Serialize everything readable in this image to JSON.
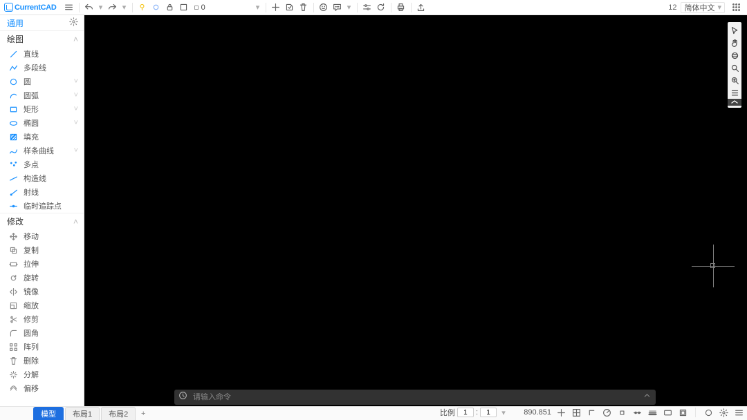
{
  "app": {
    "brand": "CurrentCAD"
  },
  "top_toolbar": {
    "layer_value": "0",
    "notif_count": "12",
    "language": "简体中文"
  },
  "sidebar": {
    "common_tab": "通用",
    "groups": {
      "draw": {
        "title": "绘图",
        "items": [
          {
            "label": "直线",
            "icon": "line",
            "expandable": false
          },
          {
            "label": "多段线",
            "icon": "polyline",
            "expandable": false
          },
          {
            "label": "圆",
            "icon": "circle",
            "expandable": true
          },
          {
            "label": "圆弧",
            "icon": "arc",
            "expandable": true
          },
          {
            "label": "矩形",
            "icon": "rect",
            "expandable": true
          },
          {
            "label": "椭圆",
            "icon": "ellipse",
            "expandable": true
          },
          {
            "label": "填充",
            "icon": "hatch",
            "expandable": false
          },
          {
            "label": "样条曲线",
            "icon": "spline",
            "expandable": true
          },
          {
            "label": "多点",
            "icon": "points",
            "expandable": false
          },
          {
            "label": "构造线",
            "icon": "xline",
            "expandable": false
          },
          {
            "label": "射线",
            "icon": "ray",
            "expandable": false
          },
          {
            "label": "临时追踪点",
            "icon": "track",
            "expandable": false
          }
        ]
      },
      "modify": {
        "title": "修改",
        "items": [
          {
            "label": "移动",
            "icon": "move"
          },
          {
            "label": "复制",
            "icon": "copy"
          },
          {
            "label": "拉伸",
            "icon": "stretch"
          },
          {
            "label": "旋转",
            "icon": "rotate"
          },
          {
            "label": "镜像",
            "icon": "mirror"
          },
          {
            "label": "缩放",
            "icon": "scale"
          },
          {
            "label": "修剪",
            "icon": "trim"
          },
          {
            "label": "圆角",
            "icon": "fillet"
          },
          {
            "label": "阵列",
            "icon": "array"
          },
          {
            "label": "删除",
            "icon": "delete"
          },
          {
            "label": "分解",
            "icon": "explode"
          },
          {
            "label": "偏移",
            "icon": "offset"
          }
        ]
      }
    }
  },
  "view_tools": [
    "cursor",
    "hand",
    "orbit",
    "zoom-window",
    "zoom-extents",
    "list"
  ],
  "command": {
    "placeholder": "请输入命令"
  },
  "tabs": {
    "items": [
      "模型",
      "布局1",
      "布局2"
    ],
    "active_index": 0
  },
  "statusbar": {
    "scale_label": "比例",
    "scale_a": "1",
    "scale_b": "1",
    "coord": "890.851",
    "toggles": [
      "snap",
      "grid",
      "ortho",
      "polar",
      "osnap",
      "otrack",
      "lwt",
      "dyn",
      "model",
      "render",
      "config",
      "more"
    ]
  }
}
